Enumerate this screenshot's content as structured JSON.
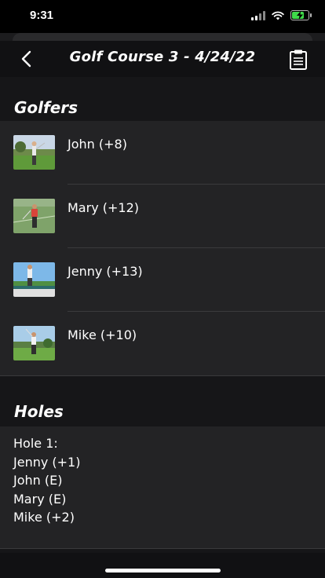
{
  "status_bar": {
    "time": "9:31",
    "icons": [
      "cellular-signal-icon",
      "wifi-icon",
      "battery-charging-icon"
    ],
    "battery_color": "#3fd94a"
  },
  "nav": {
    "title": "Golf Course 3 - 4/24/22",
    "back_icon": "chevron-left-icon",
    "action_icon": "clipboard-icon"
  },
  "golfers_section": {
    "title": "Golfers",
    "items": [
      {
        "name": "John (+8)",
        "thumb": "golfer-photo"
      },
      {
        "name": "Mary (+12)",
        "thumb": "golfer-photo"
      },
      {
        "name": "Jenny (+13)",
        "thumb": "golfer-photo"
      },
      {
        "name": "Mike (+10)",
        "thumb": "golfer-photo"
      }
    ]
  },
  "holes_section": {
    "title": "Holes",
    "lines": [
      "Hole 1:",
      "Jenny (+1)",
      "John (E)",
      "Mary (E)",
      "Mike (+2)"
    ]
  }
}
